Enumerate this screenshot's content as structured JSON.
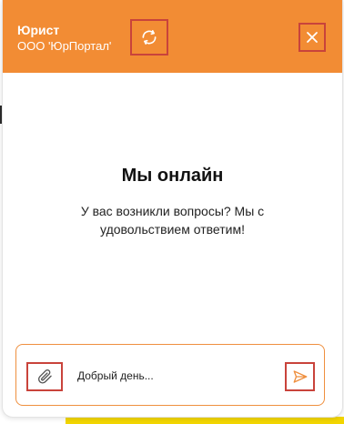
{
  "header": {
    "agent_name": "Юрист",
    "company_name": "ООО 'ЮрПортал'",
    "icons": {
      "refresh": "refresh-icon",
      "close": "close-icon"
    }
  },
  "main": {
    "headline": "Мы онлайн",
    "subtext": "У вас возникли вопросы? Мы с удовольствием ответим!"
  },
  "composer": {
    "placeholder": "Добрый день...",
    "icons": {
      "attach": "paperclip-icon",
      "send": "send-icon"
    }
  },
  "colors": {
    "accent": "#f28c34",
    "highlight": "#c9433b",
    "input_border": "#ef8f3e"
  }
}
